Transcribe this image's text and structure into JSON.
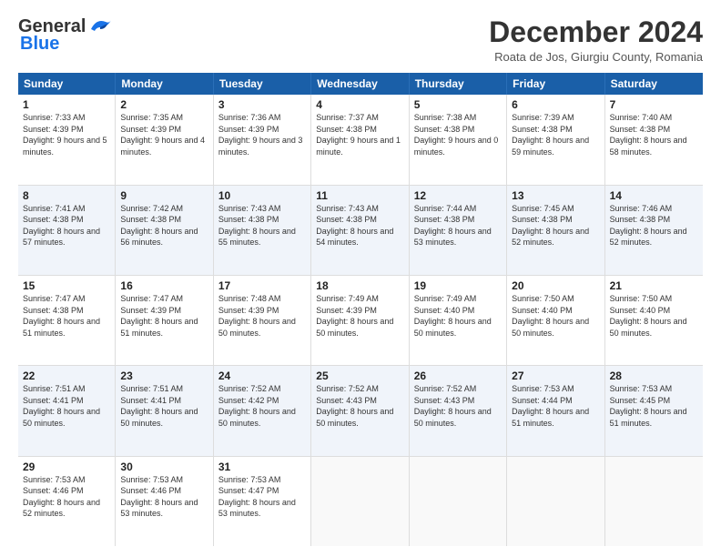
{
  "header": {
    "logo_general": "General",
    "logo_blue": "Blue",
    "month_title": "December 2024",
    "subtitle": "Roata de Jos, Giurgiu County, Romania"
  },
  "weekdays": [
    "Sunday",
    "Monday",
    "Tuesday",
    "Wednesday",
    "Thursday",
    "Friday",
    "Saturday"
  ],
  "rows": [
    [
      {
        "day": "1",
        "sunrise": "Sunrise: 7:33 AM",
        "sunset": "Sunset: 4:39 PM",
        "daylight": "Daylight: 9 hours and 5 minutes."
      },
      {
        "day": "2",
        "sunrise": "Sunrise: 7:35 AM",
        "sunset": "Sunset: 4:39 PM",
        "daylight": "Daylight: 9 hours and 4 minutes."
      },
      {
        "day": "3",
        "sunrise": "Sunrise: 7:36 AM",
        "sunset": "Sunset: 4:39 PM",
        "daylight": "Daylight: 9 hours and 3 minutes."
      },
      {
        "day": "4",
        "sunrise": "Sunrise: 7:37 AM",
        "sunset": "Sunset: 4:38 PM",
        "daylight": "Daylight: 9 hours and 1 minute."
      },
      {
        "day": "5",
        "sunrise": "Sunrise: 7:38 AM",
        "sunset": "Sunset: 4:38 PM",
        "daylight": "Daylight: 9 hours and 0 minutes."
      },
      {
        "day": "6",
        "sunrise": "Sunrise: 7:39 AM",
        "sunset": "Sunset: 4:38 PM",
        "daylight": "Daylight: 8 hours and 59 minutes."
      },
      {
        "day": "7",
        "sunrise": "Sunrise: 7:40 AM",
        "sunset": "Sunset: 4:38 PM",
        "daylight": "Daylight: 8 hours and 58 minutes."
      }
    ],
    [
      {
        "day": "8",
        "sunrise": "Sunrise: 7:41 AM",
        "sunset": "Sunset: 4:38 PM",
        "daylight": "Daylight: 8 hours and 57 minutes."
      },
      {
        "day": "9",
        "sunrise": "Sunrise: 7:42 AM",
        "sunset": "Sunset: 4:38 PM",
        "daylight": "Daylight: 8 hours and 56 minutes."
      },
      {
        "day": "10",
        "sunrise": "Sunrise: 7:43 AM",
        "sunset": "Sunset: 4:38 PM",
        "daylight": "Daylight: 8 hours and 55 minutes."
      },
      {
        "day": "11",
        "sunrise": "Sunrise: 7:43 AM",
        "sunset": "Sunset: 4:38 PM",
        "daylight": "Daylight: 8 hours and 54 minutes."
      },
      {
        "day": "12",
        "sunrise": "Sunrise: 7:44 AM",
        "sunset": "Sunset: 4:38 PM",
        "daylight": "Daylight: 8 hours and 53 minutes."
      },
      {
        "day": "13",
        "sunrise": "Sunrise: 7:45 AM",
        "sunset": "Sunset: 4:38 PM",
        "daylight": "Daylight: 8 hours and 52 minutes."
      },
      {
        "day": "14",
        "sunrise": "Sunrise: 7:46 AM",
        "sunset": "Sunset: 4:38 PM",
        "daylight": "Daylight: 8 hours and 52 minutes."
      }
    ],
    [
      {
        "day": "15",
        "sunrise": "Sunrise: 7:47 AM",
        "sunset": "Sunset: 4:38 PM",
        "daylight": "Daylight: 8 hours and 51 minutes."
      },
      {
        "day": "16",
        "sunrise": "Sunrise: 7:47 AM",
        "sunset": "Sunset: 4:39 PM",
        "daylight": "Daylight: 8 hours and 51 minutes."
      },
      {
        "day": "17",
        "sunrise": "Sunrise: 7:48 AM",
        "sunset": "Sunset: 4:39 PM",
        "daylight": "Daylight: 8 hours and 50 minutes."
      },
      {
        "day": "18",
        "sunrise": "Sunrise: 7:49 AM",
        "sunset": "Sunset: 4:39 PM",
        "daylight": "Daylight: 8 hours and 50 minutes."
      },
      {
        "day": "19",
        "sunrise": "Sunrise: 7:49 AM",
        "sunset": "Sunset: 4:40 PM",
        "daylight": "Daylight: 8 hours and 50 minutes."
      },
      {
        "day": "20",
        "sunrise": "Sunrise: 7:50 AM",
        "sunset": "Sunset: 4:40 PM",
        "daylight": "Daylight: 8 hours and 50 minutes."
      },
      {
        "day": "21",
        "sunrise": "Sunrise: 7:50 AM",
        "sunset": "Sunset: 4:40 PM",
        "daylight": "Daylight: 8 hours and 50 minutes."
      }
    ],
    [
      {
        "day": "22",
        "sunrise": "Sunrise: 7:51 AM",
        "sunset": "Sunset: 4:41 PM",
        "daylight": "Daylight: 8 hours and 50 minutes."
      },
      {
        "day": "23",
        "sunrise": "Sunrise: 7:51 AM",
        "sunset": "Sunset: 4:41 PM",
        "daylight": "Daylight: 8 hours and 50 minutes."
      },
      {
        "day": "24",
        "sunrise": "Sunrise: 7:52 AM",
        "sunset": "Sunset: 4:42 PM",
        "daylight": "Daylight: 8 hours and 50 minutes."
      },
      {
        "day": "25",
        "sunrise": "Sunrise: 7:52 AM",
        "sunset": "Sunset: 4:43 PM",
        "daylight": "Daylight: 8 hours and 50 minutes."
      },
      {
        "day": "26",
        "sunrise": "Sunrise: 7:52 AM",
        "sunset": "Sunset: 4:43 PM",
        "daylight": "Daylight: 8 hours and 50 minutes."
      },
      {
        "day": "27",
        "sunrise": "Sunrise: 7:53 AM",
        "sunset": "Sunset: 4:44 PM",
        "daylight": "Daylight: 8 hours and 51 minutes."
      },
      {
        "day": "28",
        "sunrise": "Sunrise: 7:53 AM",
        "sunset": "Sunset: 4:45 PM",
        "daylight": "Daylight: 8 hours and 51 minutes."
      }
    ],
    [
      {
        "day": "29",
        "sunrise": "Sunrise: 7:53 AM",
        "sunset": "Sunset: 4:46 PM",
        "daylight": "Daylight: 8 hours and 52 minutes."
      },
      {
        "day": "30",
        "sunrise": "Sunrise: 7:53 AM",
        "sunset": "Sunset: 4:46 PM",
        "daylight": "Daylight: 8 hours and 53 minutes."
      },
      {
        "day": "31",
        "sunrise": "Sunrise: 7:53 AM",
        "sunset": "Sunset: 4:47 PM",
        "daylight": "Daylight: 8 hours and 53 minutes."
      },
      {
        "day": "",
        "sunrise": "",
        "sunset": "",
        "daylight": ""
      },
      {
        "day": "",
        "sunrise": "",
        "sunset": "",
        "daylight": ""
      },
      {
        "day": "",
        "sunrise": "",
        "sunset": "",
        "daylight": ""
      },
      {
        "day": "",
        "sunrise": "",
        "sunset": "",
        "daylight": ""
      }
    ]
  ]
}
